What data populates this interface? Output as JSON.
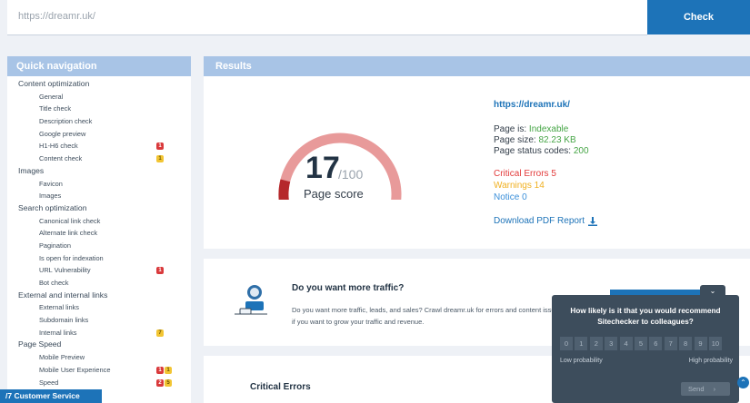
{
  "search": {
    "url": "https://dreamr.uk/",
    "check_label": "Check"
  },
  "nav": {
    "header": "Quick navigation",
    "items": [
      {
        "label": "Content optimization",
        "type": "section"
      },
      {
        "label": "General",
        "type": "sub"
      },
      {
        "label": "Title check",
        "type": "sub"
      },
      {
        "label": "Description check",
        "type": "sub"
      },
      {
        "label": "Google preview",
        "type": "sub"
      },
      {
        "label": "H1-H6 check",
        "type": "sub",
        "badges": [
          {
            "color": "red",
            "value": "1"
          }
        ]
      },
      {
        "label": "Content check",
        "type": "sub",
        "badges": [
          {
            "color": "yellow",
            "value": "1"
          }
        ]
      },
      {
        "label": "Images",
        "type": "section"
      },
      {
        "label": "Favicon",
        "type": "sub"
      },
      {
        "label": "Images",
        "type": "sub"
      },
      {
        "label": "Search optimization",
        "type": "section"
      },
      {
        "label": "Canonical link check",
        "type": "sub"
      },
      {
        "label": "Alternate link check",
        "type": "sub"
      },
      {
        "label": "Pagination",
        "type": "sub"
      },
      {
        "label": "Is open for indexation",
        "type": "sub"
      },
      {
        "label": "URL Vulnerability",
        "type": "sub",
        "badges": [
          {
            "color": "red",
            "value": "1"
          }
        ]
      },
      {
        "label": "Bot check",
        "type": "sub"
      },
      {
        "label": "External and internal links",
        "type": "section"
      },
      {
        "label": "External links",
        "type": "sub"
      },
      {
        "label": "Subdomain links",
        "type": "sub"
      },
      {
        "label": "Internal links",
        "type": "sub",
        "badges": [
          {
            "color": "yellow",
            "value": "7"
          }
        ]
      },
      {
        "label": "Page Speed",
        "type": "section"
      },
      {
        "label": "Mobile Preview",
        "type": "sub"
      },
      {
        "label": "Mobile User Experience",
        "type": "sub",
        "badges": [
          {
            "color": "red",
            "value": "1"
          },
          {
            "color": "yellow",
            "value": "1"
          }
        ]
      },
      {
        "label": "Speed",
        "type": "sub",
        "badges": [
          {
            "color": "red",
            "value": "2"
          },
          {
            "color": "yellow",
            "value": "5"
          }
        ]
      }
    ]
  },
  "customer_service": "/7 Customer Service",
  "results": {
    "header": "Results",
    "score": "17",
    "score_max": "/100",
    "score_label": "Page score",
    "score_fraction": 0.17,
    "url": "https://dreamr.uk/",
    "page_is_label": "Page is: ",
    "page_is_value": "Indexable",
    "page_size_label": "Page size: ",
    "page_size_value": "82.23 KB",
    "status_label": "Page status codes: ",
    "status_value": "200",
    "critical_errors": "Critical Errors 5",
    "warnings": "Warnings 14",
    "notice": "Notice 0",
    "download": "Download PDF Report"
  },
  "traffic": {
    "title": "Do you want more traffic?",
    "text": "Do you want more traffic, leads, and sales? Crawl dreamr.uk for errors and content issues if you want to grow your traffic and revenue."
  },
  "critical": {
    "title": "Critical Errors"
  },
  "survey": {
    "question": "How likely is it that you would recommend Sitechecker to colleagues?",
    "scale": [
      "0",
      "1",
      "2",
      "3",
      "4",
      "5",
      "6",
      "7",
      "8",
      "9",
      "10"
    ],
    "low": "Low probability",
    "high": "High probability",
    "send": "Send"
  },
  "colors": {
    "accent": "#1d73b8",
    "gauge_bg": "#e89a9a",
    "gauge_fg": "#b5282b"
  }
}
